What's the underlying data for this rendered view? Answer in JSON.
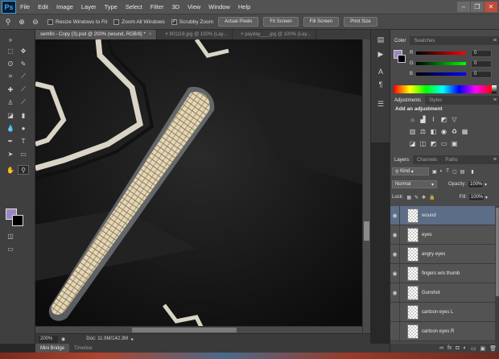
{
  "app": {
    "logo": "Ps"
  },
  "menu": [
    "File",
    "Edit",
    "Image",
    "Layer",
    "Type",
    "Select",
    "Filter",
    "3D",
    "View",
    "Window",
    "Help"
  ],
  "window_controls": {
    "minimize": "–",
    "maximize": "❐",
    "close": "✕"
  },
  "options": {
    "resize_windows": {
      "label": "Resize Windows to Fit",
      "checked": false
    },
    "zoom_all_windows": {
      "label": "Zoom All Windows",
      "checked": false
    },
    "scrubby_zoom": {
      "label": "Scrubby Zoom",
      "checked": true
    },
    "buttons": [
      "Actual Pixels",
      "Fit Screen",
      "Fill Screen",
      "Print Size"
    ]
  },
  "tabs": [
    {
      "label": "semfin - Copy (3).psd @ 200% (wound, RGB/8) *",
      "active": true
    },
    {
      "label": "801118.jpg @ 100% (Lay...",
      "active": false
    },
    {
      "label": "payday___.jpg @ 100% (Lay...",
      "active": false
    }
  ],
  "status": {
    "zoom": "200%",
    "doc_info": "Doc: 11.9M/142.3M"
  },
  "bottom_tabs": [
    {
      "label": "Mini Bridge",
      "active": true
    },
    {
      "label": "Timeline",
      "active": false
    }
  ],
  "color_panel": {
    "tabs": [
      "Color",
      "Swatches"
    ],
    "sliders": [
      {
        "label": "R",
        "value": "0"
      },
      {
        "label": "G",
        "value": "0"
      },
      {
        "label": "B",
        "value": "0"
      }
    ]
  },
  "adjustments_panel": {
    "tabs": [
      "Adjustments",
      "Styles"
    ],
    "title": "Add an adjustment"
  },
  "layers_panel": {
    "tabs": [
      "Layers",
      "Channels",
      "Paths"
    ],
    "filter_kind": "Kind",
    "blend_mode": "Normal",
    "opacity_label": "Opacity:",
    "opacity": "100%",
    "lock_label": "Lock:",
    "fill_label": "Fill:",
    "fill": "100%",
    "layers": [
      {
        "name": "wound",
        "visible": true,
        "selected": true
      },
      {
        "name": "eyes",
        "visible": true,
        "selected": false
      },
      {
        "name": "angry eyes",
        "visible": true,
        "selected": false
      },
      {
        "name": "fingers w/o thumb",
        "visible": true,
        "selected": false
      },
      {
        "name": "Gunshot",
        "visible": true,
        "selected": false
      },
      {
        "name": "cartoon eyes L",
        "visible": false,
        "selected": false
      },
      {
        "name": "cartoon eyes R",
        "visible": false,
        "selected": false
      }
    ]
  },
  "colors": {
    "foreground": "#9a87c2",
    "background": "#000000",
    "accent": "#5b6d87"
  }
}
